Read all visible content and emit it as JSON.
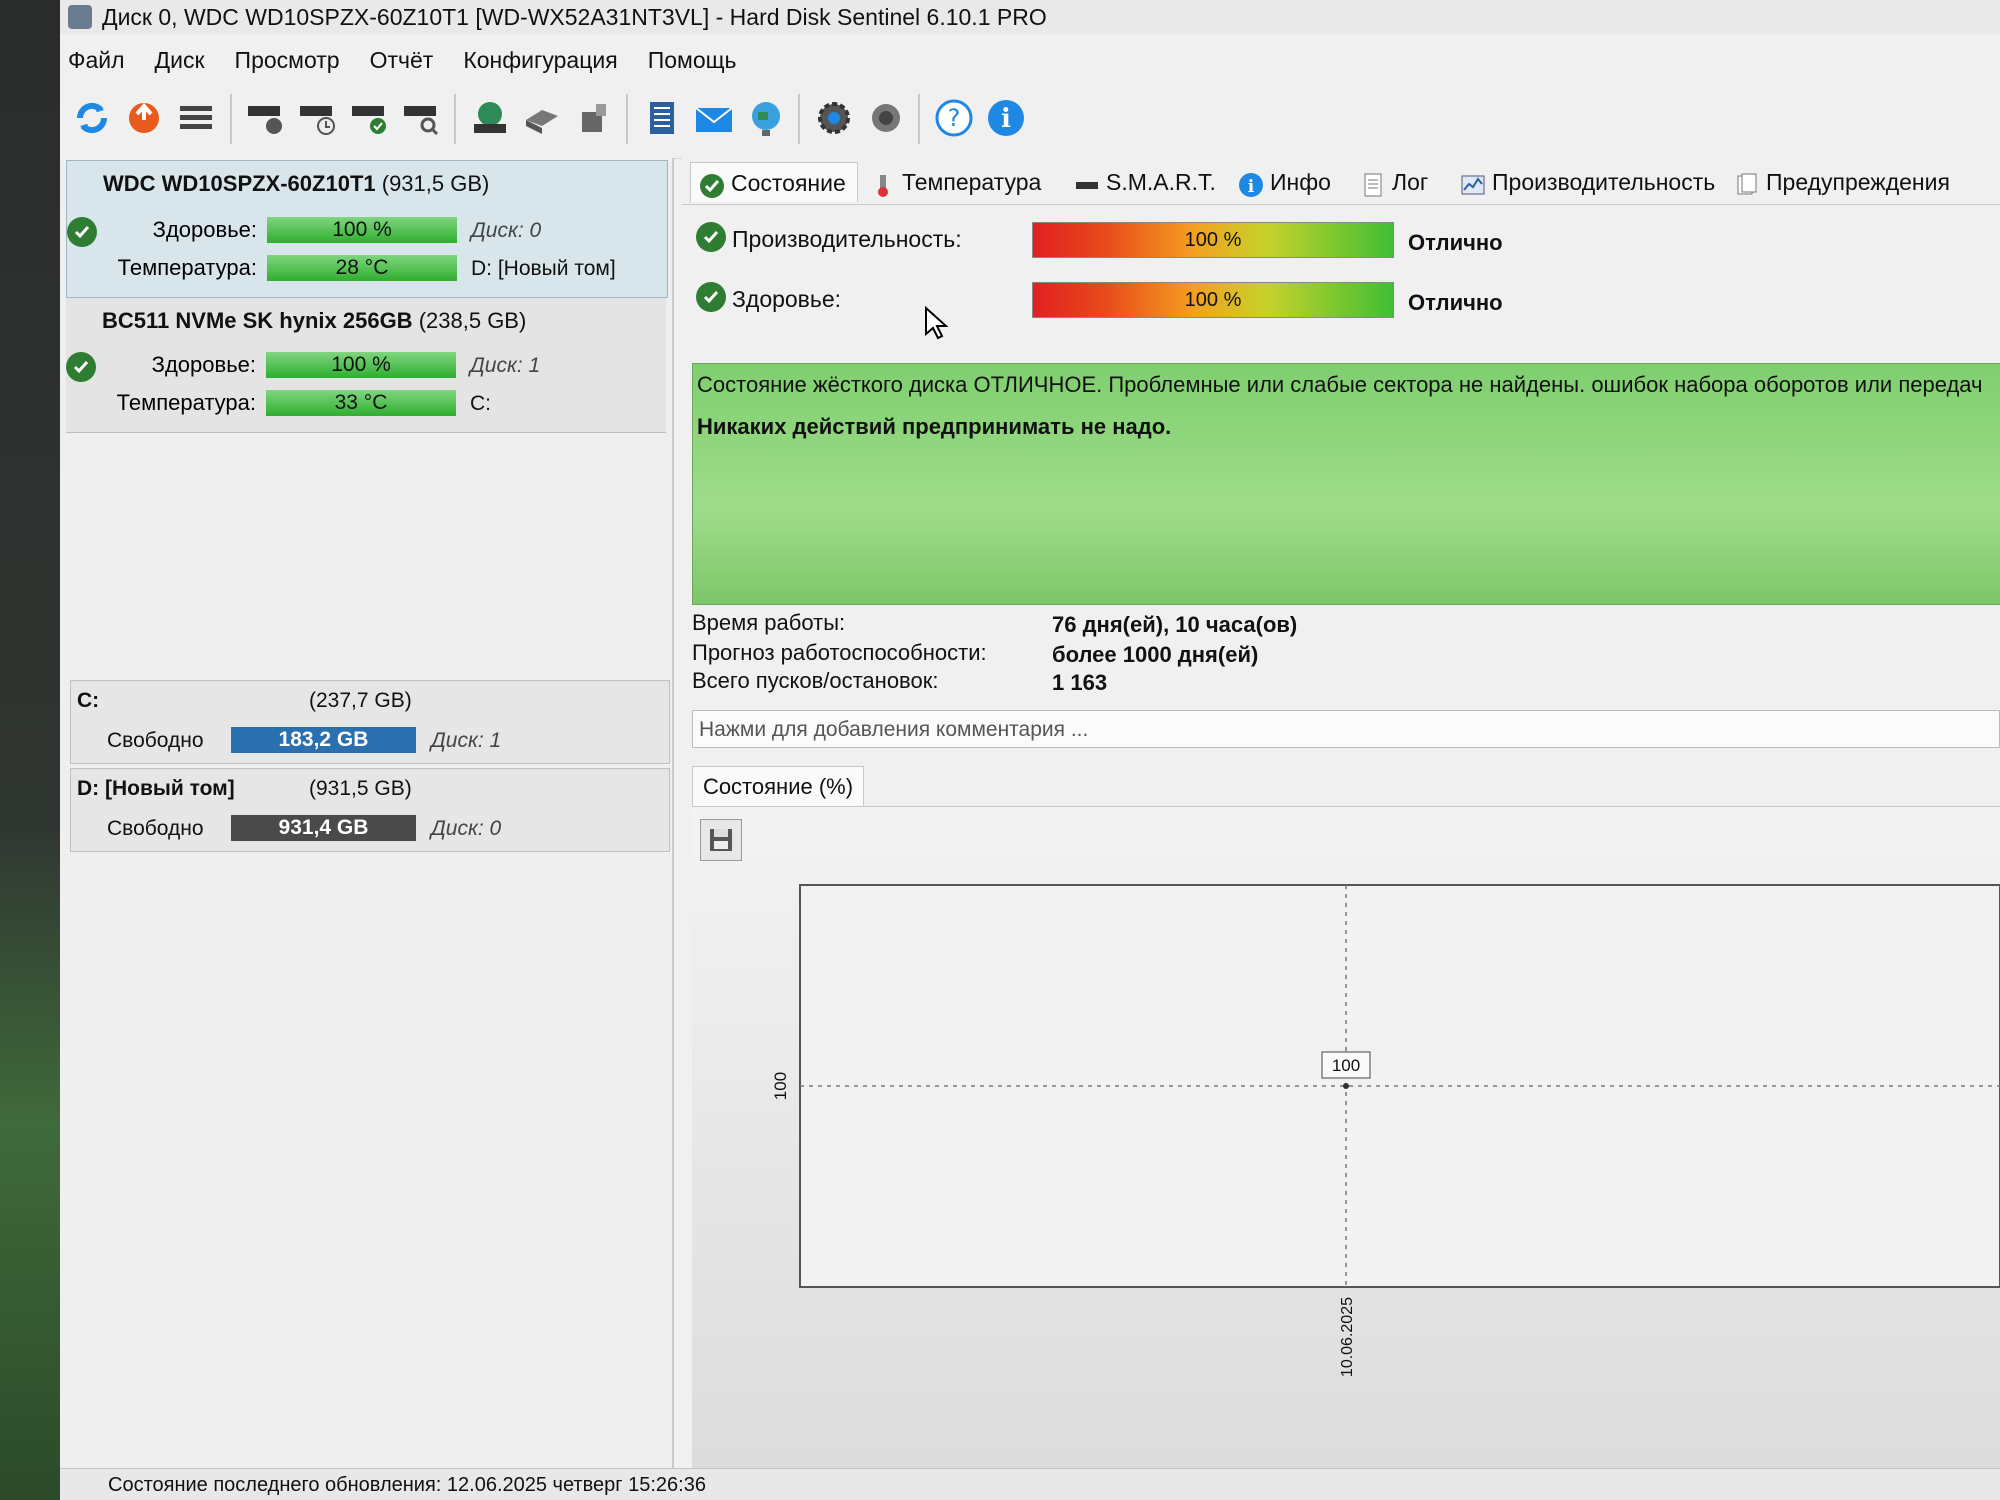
{
  "window": {
    "title": "Диск 0, WDC WD10SPZX-60Z10T1 [WD-WX52A31NT3VL]  -  Hard Disk Sentinel 6.10.1 PRO"
  },
  "menu": [
    "Файл",
    "Диск",
    "Просмотр",
    "Отчёт",
    "Конфигурация",
    "Помощь"
  ],
  "toolbar": {
    "icons": [
      "refresh-icon",
      "update-icon",
      "list-icon",
      "disk-test-icon",
      "disk-schedule-icon",
      "disk-ok-icon",
      "disk-search-icon",
      "network-disk-icon",
      "external-disk-icon",
      "usb-disk-icon",
      "report-icon",
      "mail-icon",
      "globe-icon",
      "settings-icon",
      "sound-icon",
      "help-icon",
      "info-icon"
    ]
  },
  "disks": [
    {
      "name": "WDC WD10SPZX-60Z10T1",
      "size": "(931,5 GB)",
      "health_label": "Здоровье:",
      "health": "100 %",
      "disk_no": "Диск: 0",
      "temp_label": "Температура:",
      "temp": "28 °C",
      "volume": "D: [Новый том]"
    },
    {
      "name": "BC511 NVMe SK hynix 256GB",
      "size": "(238,5 GB)",
      "health_label": "Здоровье:",
      "health": "100 %",
      "disk_no": "Диск: 1",
      "temp_label": "Температура:",
      "temp": "33 °C",
      "volume": "C:"
    }
  ],
  "partitions": [
    {
      "name": "C:",
      "size": "(237,7 GB)",
      "free_label": "Свободно",
      "free": "183,2 GB",
      "disk_no": "Диск: 1",
      "bar_color": "#2a6fb0"
    },
    {
      "name": "D: [Новый том]",
      "size": "(931,5 GB)",
      "free_label": "Свободно",
      "free": "931,4 GB",
      "disk_no": "Диск: 0",
      "bar_color": "#4a4a4a"
    }
  ],
  "tabs": [
    "Состояние",
    "Температура",
    "S.M.A.R.T.",
    "Инфо",
    "Лог",
    "Производительность",
    "Предупреждения"
  ],
  "status": {
    "performance_label": "Производительность:",
    "performance_value": "100 %",
    "performance_percent": 100,
    "performance_grade": "Отлично",
    "health_label": "Здоровье:",
    "health_value": "100 %",
    "health_percent": 100,
    "health_grade": "Отлично",
    "message": "Состояние жёсткого диска ОТЛИЧНОЕ. Проблемные или слабые сектора не найдены. ошибок набора оборотов или передач",
    "advice": "Никаких действий предпринимать не надо.",
    "uptime_label": "Время работы:",
    "uptime_value": "76 дня(ей), 10 часа(ов)",
    "forecast_label": "Прогноз работоспособности:",
    "forecast_value": "более 1000 дня(ей)",
    "starts_label": "Всего пусков/остановок:",
    "starts_value": "1 163",
    "comment_placeholder": "Нажми для добавления комментария ..."
  },
  "chart_tab": "Состояние (%)",
  "chart_data": {
    "type": "line",
    "x": [
      "10.06.2025"
    ],
    "series": [
      {
        "values": [
          100
        ]
      }
    ],
    "y_tick_labels": [
      "100"
    ],
    "data_labels": [
      "100"
    ],
    "grid": true
  },
  "statusbar": "Состояние последнего обновления: 12.06.2025 четверг 15:26:36"
}
